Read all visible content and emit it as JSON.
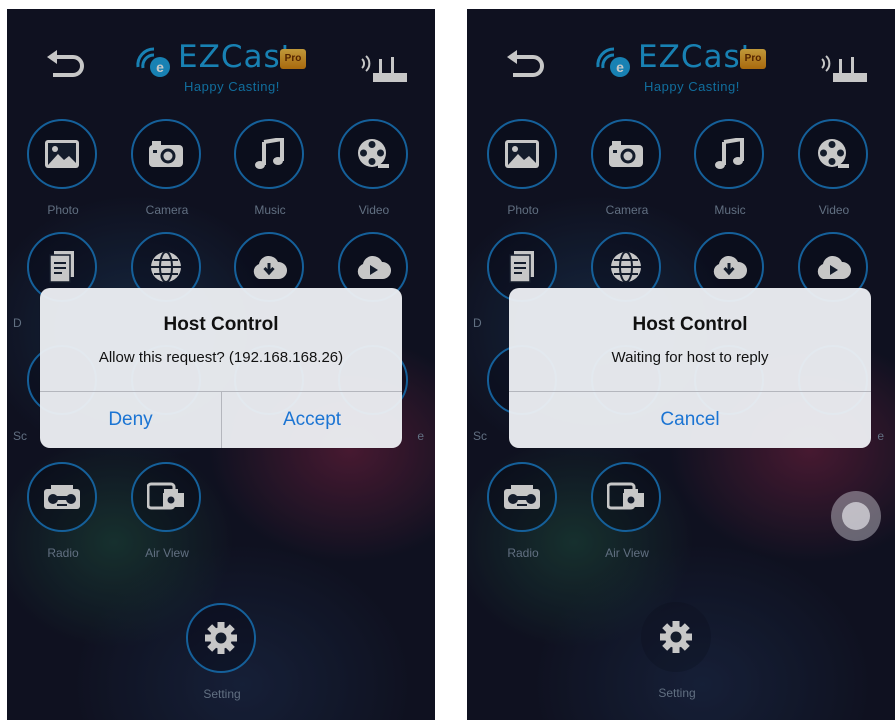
{
  "app": {
    "name": "EZCast",
    "badge": "Pro",
    "tagline": "Happy Casting!",
    "accent_color": "#1fa6e6",
    "dialog_button_color": "#1b74d3"
  },
  "screens": [
    {
      "grid": [
        {
          "label": "Photo",
          "icon": "photo-icon"
        },
        {
          "label": "Camera",
          "icon": "camera-icon"
        },
        {
          "label": "Music",
          "icon": "music-icon"
        },
        {
          "label": "Video",
          "icon": "video-icon"
        },
        {
          "label": "D",
          "icon": "document-icon"
        },
        {
          "label": "",
          "icon": "web-icon"
        },
        {
          "label": "",
          "icon": "cloud-download-icon"
        },
        {
          "label": "",
          "icon": "cloud-video-icon"
        },
        {
          "label": "Sc",
          "icon": ""
        },
        {
          "label": "",
          "icon": ""
        },
        {
          "label": "",
          "icon": ""
        },
        {
          "label": "e",
          "icon": ""
        },
        {
          "label": "Radio",
          "icon": "radio-icon"
        },
        {
          "label": "Air View",
          "icon": "airview-icon"
        }
      ],
      "setting_label": "Setting",
      "dialog": {
        "title": "Host Control",
        "message": "Allow this request? (192.168.168.26)",
        "buttons": [
          "Deny",
          "Accept"
        ]
      }
    },
    {
      "grid": [
        {
          "label": "Photo",
          "icon": "photo-icon"
        },
        {
          "label": "Camera",
          "icon": "camera-icon"
        },
        {
          "label": "Music",
          "icon": "music-icon"
        },
        {
          "label": "Video",
          "icon": "video-icon"
        },
        {
          "label": "D",
          "icon": "document-icon"
        },
        {
          "label": "",
          "icon": "web-icon"
        },
        {
          "label": "",
          "icon": "cloud-download-icon"
        },
        {
          "label": "",
          "icon": "cloud-video-icon"
        },
        {
          "label": "Sc",
          "icon": ""
        },
        {
          "label": "",
          "icon": ""
        },
        {
          "label": "",
          "icon": ""
        },
        {
          "label": "e",
          "icon": ""
        },
        {
          "label": "Radio",
          "icon": "radio-icon"
        },
        {
          "label": "Air View",
          "icon": "airview-icon"
        }
      ],
      "setting_label": "Setting",
      "dialog": {
        "title": "Host Control",
        "message": "Waiting for host to reply",
        "buttons": [
          "Cancel"
        ]
      }
    }
  ]
}
